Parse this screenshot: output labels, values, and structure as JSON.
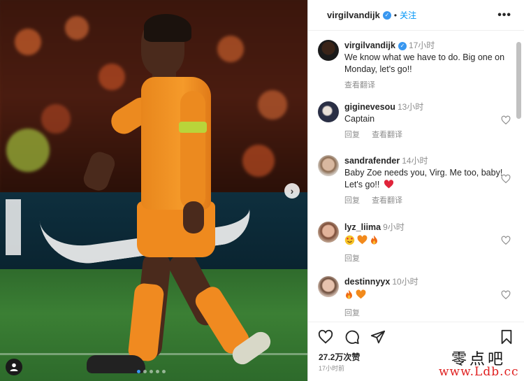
{
  "post": {
    "author": "virgilvandijk",
    "follow_label": "关注",
    "dot": "•",
    "more_label": "•••",
    "next_label": "›"
  },
  "comments": [
    {
      "user": "virgilvandijk",
      "time": "17小时",
      "text": "We know what we have to do. Big one on Monday, let's go!!",
      "actions": [
        "查看翻译"
      ],
      "verified": true
    },
    {
      "user": "giginevesou",
      "time": "13小时",
      "text": "Captain",
      "actions": [
        "回复",
        "查看翻译"
      ]
    },
    {
      "user": "sandrafender",
      "time": "14小时",
      "text": "Baby Zoe needs you, Virg. Me too, baby! Let's go!!",
      "actions": [
        "回复",
        "查看翻译"
      ]
    },
    {
      "user": "lyz_liima",
      "time": "9小时",
      "text": "",
      "actions": [
        "回复"
      ],
      "emoji": [
        "smiling-face-hearts",
        "orange-heart",
        "fire"
      ]
    },
    {
      "user": "destinnyyx",
      "time": "10小时",
      "text": "",
      "actions": [
        "回复"
      ],
      "emoji": [
        "fire",
        "orange-heart"
      ]
    }
  ],
  "footer": {
    "likes": "27.2万次赞",
    "time_ago": "17小时前"
  },
  "watermark": {
    "top": "零点吧",
    "bottom": "www.Ldb.cc"
  },
  "colors": {
    "accent": "#0095f6",
    "verified": "#3897f0",
    "muted": "#8e8e8e",
    "heart_red": "#e0243a",
    "watermark_red": "#e02020"
  }
}
